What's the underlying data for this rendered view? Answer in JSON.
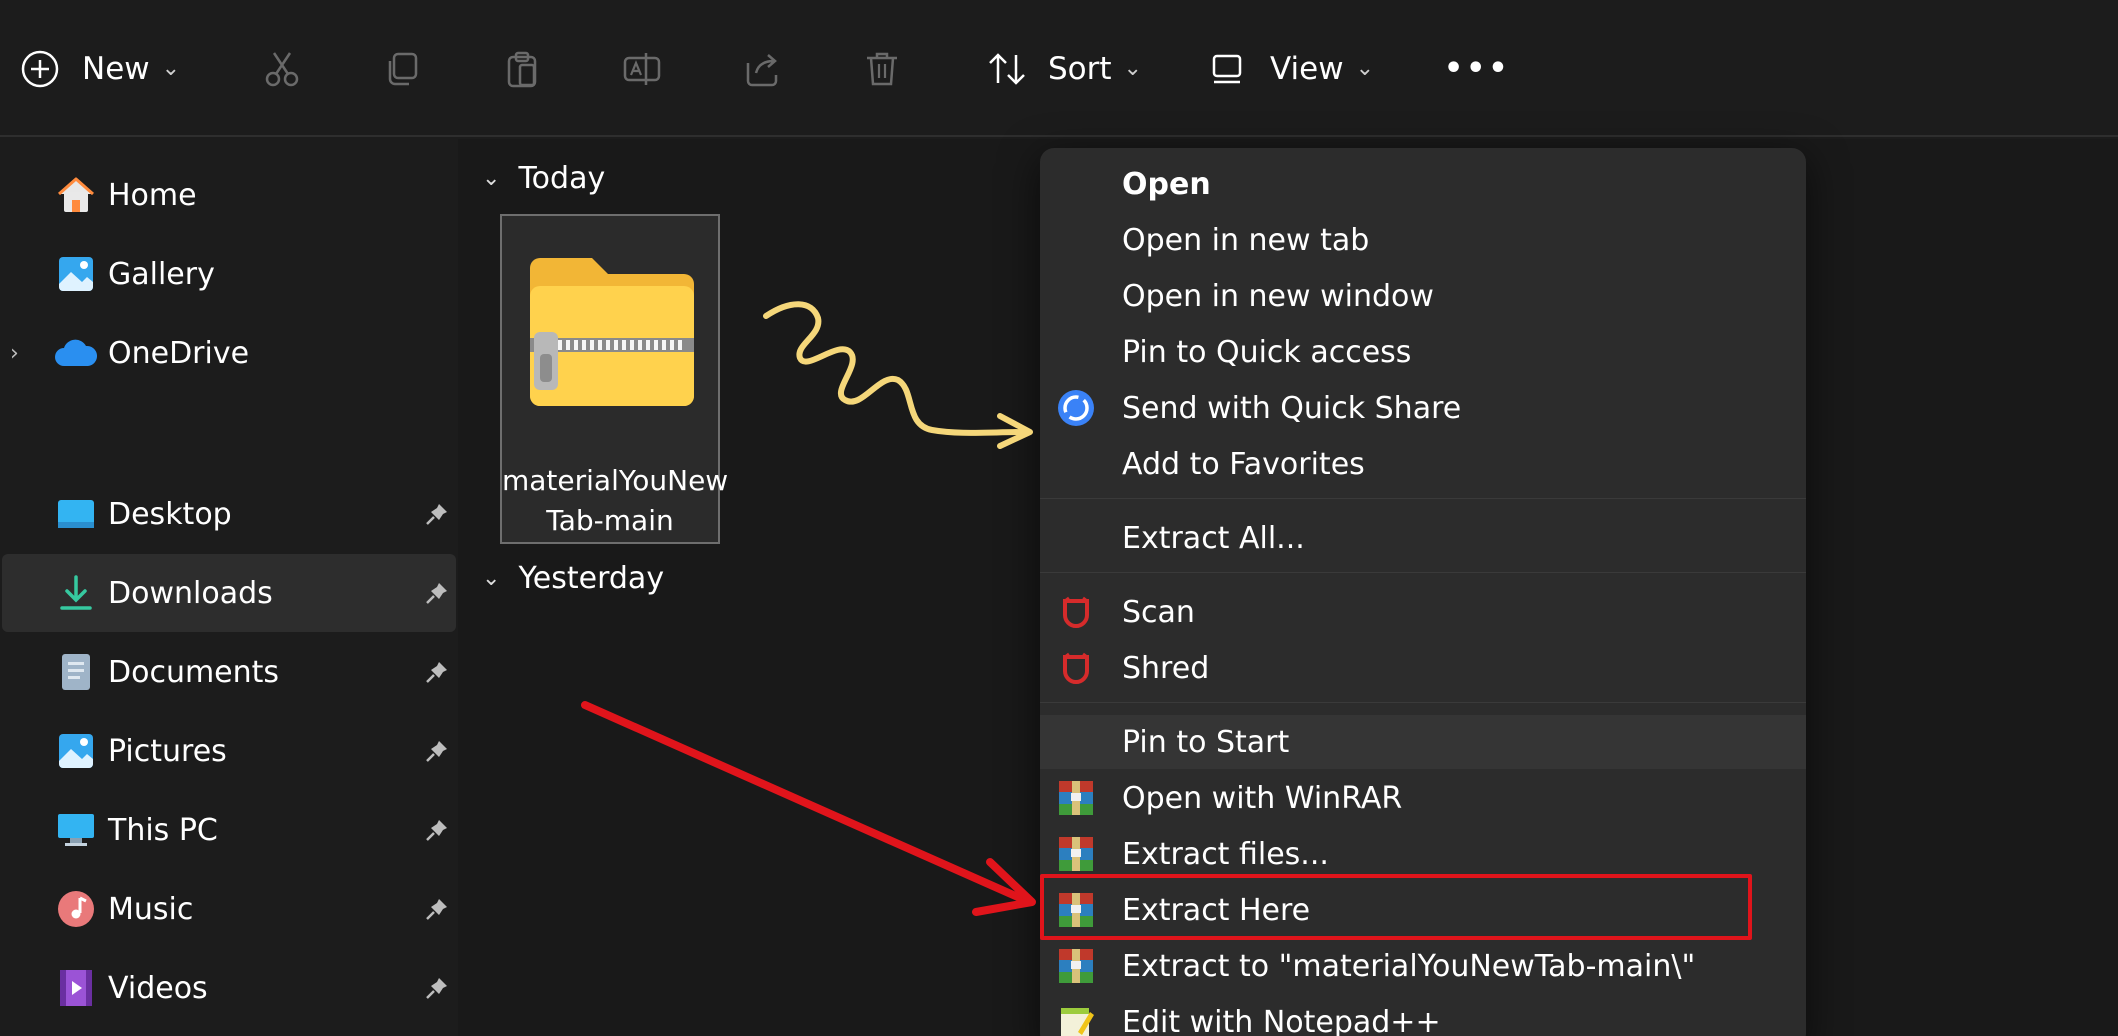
{
  "toolbar": {
    "new_label": "New",
    "sort_label": "Sort",
    "view_label": "View",
    "more_label": "•••",
    "icons": [
      "plus-circle-icon",
      "cut-icon",
      "copy-icon",
      "paste-icon",
      "rename-icon",
      "share-icon",
      "delete-icon",
      "sort-icon",
      "view-icon"
    ]
  },
  "sidebar": {
    "top_items": [
      {
        "label": "Home",
        "icon": "home-icon"
      },
      {
        "label": "Gallery",
        "icon": "gallery-icon"
      },
      {
        "label": "OneDrive",
        "icon": "cloud-icon",
        "expander": "›"
      }
    ],
    "pinned_items": [
      {
        "label": "Desktop",
        "icon": "desktop-icon"
      },
      {
        "label": "Downloads",
        "icon": "download-icon",
        "selected": true
      },
      {
        "label": "Documents",
        "icon": "documents-icon"
      },
      {
        "label": "Pictures",
        "icon": "pictures-icon"
      },
      {
        "label": "This PC",
        "icon": "computer-icon"
      },
      {
        "label": "Music",
        "icon": "music-icon"
      },
      {
        "label": "Videos",
        "icon": "videos-icon"
      }
    ]
  },
  "content": {
    "groups": [
      {
        "label": "Today"
      },
      {
        "label": "Yesterday"
      }
    ],
    "file": {
      "name_line1": "materialYouNew",
      "name_line2": "Tab-main",
      "icon": "zip-folder-icon"
    }
  },
  "context_menu": {
    "items": [
      {
        "label": "Open",
        "bold": true
      },
      {
        "label": "Open in new tab"
      },
      {
        "label": "Open in new window"
      },
      {
        "label": "Pin to Quick access"
      },
      {
        "label": "Send with Quick Share",
        "icon": "quick-share-icon"
      },
      {
        "label": "Add to Favorites"
      },
      {
        "label": "Extract All..."
      },
      {
        "label": "Scan",
        "icon": "antivirus-icon"
      },
      {
        "label": "Shred",
        "icon": "antivirus-icon"
      },
      {
        "label": "Pin to Start",
        "hover": true
      },
      {
        "label": "Open with WinRAR",
        "icon": "winrar-icon"
      },
      {
        "label": "Extract files...",
        "icon": "winrar-icon"
      },
      {
        "label": "Extract Here",
        "icon": "winrar-icon",
        "highlighted": true
      },
      {
        "label": "Extract to \"materialYouNewTab-main\\\"",
        "icon": "winrar-icon"
      },
      {
        "label": "Edit with Notepad++",
        "icon": "notepadpp-icon"
      }
    ]
  },
  "colors": {
    "background": "#1c1c1c",
    "menu_bg": "#2c2c2c",
    "highlight_red": "#e0141b",
    "arrow_yellow": "#f5d77a",
    "folder_yellow": "#ffd24d"
  }
}
